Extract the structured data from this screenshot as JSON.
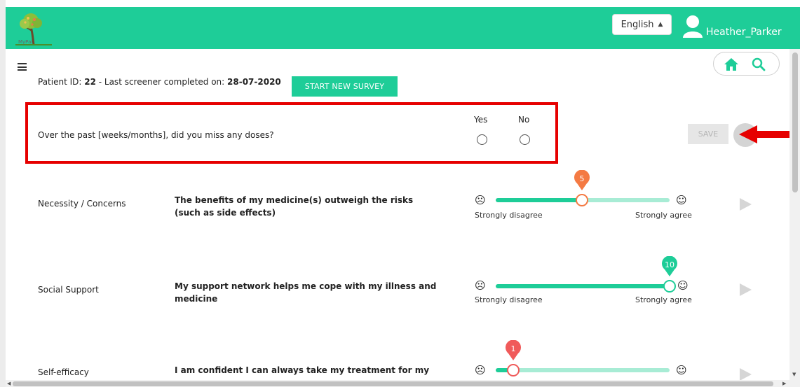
{
  "header": {
    "logo_text": "MyPal",
    "language": "English",
    "username": "Heather_Parker",
    "colors": {
      "brand": "#1ecd98"
    }
  },
  "patient": {
    "id_label": "Patient ID: ",
    "id": "22",
    "last_label": " - Last screener completed on: ",
    "last_date": "28-07-2020"
  },
  "start_button": "START NEW SURVEY",
  "question": {
    "text": "Over the past [weeks/months], did you miss any doses?",
    "yes": "Yes",
    "no": "No"
  },
  "save_button": "SAVE",
  "rows": [
    {
      "category": "Necessity / Concerns",
      "question": "The benefits of my medicine(s) outweigh the risks (such as side effects)",
      "value": 5,
      "pin_color": "#f47a43",
      "low": "Strongly disagree",
      "high": "Strongly agree"
    },
    {
      "category": "Social Support",
      "question": "My support network helps me cope with my illness and medicine",
      "value": 10,
      "pin_color": "#1ecd98",
      "low": "Strongly disagree",
      "high": "Strongly agree"
    },
    {
      "category": "Self-efficacy",
      "question": "I am confident I can always take my treatment for my",
      "value": 1,
      "pin_color": "#f05a5a"
    }
  ],
  "icons": {
    "menu": "hamburger-icon",
    "home": "home-icon",
    "search": "search-icon",
    "user": "user-avatar-icon",
    "sad": "sad-face-icon",
    "happy": "happy-face-icon",
    "play": "play-icon"
  }
}
